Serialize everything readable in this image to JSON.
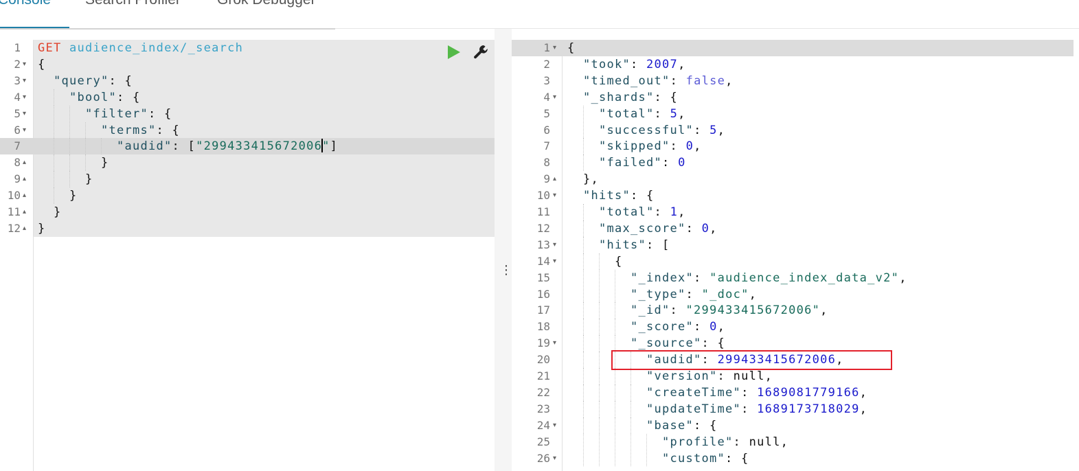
{
  "tabs": [
    {
      "label": "Console",
      "active": true
    },
    {
      "label": "Search Profiler",
      "active": false
    },
    {
      "label": "Grok Debugger",
      "active": false
    }
  ],
  "colors": {
    "accent": "#1e7fa8",
    "run_button": "#54b948",
    "highlight_box": "#e3212b"
  },
  "request_editor": {
    "run_icon": "play-icon",
    "settings_icon": "wrench-icon",
    "active_line": 7,
    "lines": [
      {
        "n": "1",
        "fold": "",
        "indent": 0,
        "tokens": [
          [
            "GET",
            "method"
          ],
          [
            " ",
            "p"
          ],
          [
            "audience_index/_search",
            "url"
          ]
        ]
      },
      {
        "n": "2",
        "fold": "▾",
        "indent": 0,
        "tokens": [
          [
            "{",
            "p"
          ]
        ]
      },
      {
        "n": "3",
        "fold": "▾",
        "indent": 1,
        "tokens": [
          [
            "\"query\"",
            "key"
          ],
          [
            ": {",
            "p"
          ]
        ]
      },
      {
        "n": "4",
        "fold": "▾",
        "indent": 2,
        "tokens": [
          [
            "\"bool\"",
            "key"
          ],
          [
            ": {",
            "p"
          ]
        ]
      },
      {
        "n": "5",
        "fold": "▾",
        "indent": 3,
        "tokens": [
          [
            "\"filter\"",
            "key"
          ],
          [
            ": {",
            "p"
          ]
        ]
      },
      {
        "n": "6",
        "fold": "▾",
        "indent": 4,
        "tokens": [
          [
            "\"terms\"",
            "key"
          ],
          [
            ": {",
            "p"
          ]
        ]
      },
      {
        "n": "7",
        "fold": "",
        "indent": 5,
        "tokens": [
          [
            "\"audid\"",
            "key"
          ],
          [
            ": [",
            "p"
          ],
          [
            "\"299433415672006",
            "str"
          ],
          [
            "|cursor",
            "cursor"
          ],
          [
            "\"",
            "str"
          ],
          [
            "]",
            "p"
          ]
        ]
      },
      {
        "n": "8",
        "fold": "▴",
        "indent": 4,
        "tokens": [
          [
            "}",
            "p"
          ]
        ]
      },
      {
        "n": "9",
        "fold": "▴",
        "indent": 3,
        "tokens": [
          [
            "}",
            "p"
          ]
        ]
      },
      {
        "n": "10",
        "fold": "▴",
        "indent": 2,
        "tokens": [
          [
            "}",
            "p"
          ]
        ]
      },
      {
        "n": "11",
        "fold": "▴",
        "indent": 1,
        "tokens": [
          [
            "}",
            "p"
          ]
        ]
      },
      {
        "n": "12",
        "fold": "▴",
        "indent": 0,
        "tokens": [
          [
            "}",
            "p"
          ]
        ]
      }
    ]
  },
  "splitter_icon": "vertical-ellipsis-icon",
  "response_viewer": {
    "active_line": 1,
    "highlighted_line": 20,
    "lines": [
      {
        "n": "1",
        "fold": "▾",
        "indent": 0,
        "tokens": [
          [
            "{",
            "p"
          ]
        ]
      },
      {
        "n": "2",
        "fold": "",
        "indent": 1,
        "tokens": [
          [
            "\"took\"",
            "key"
          ],
          [
            ": ",
            "p"
          ],
          [
            "2007",
            "num"
          ],
          [
            ",",
            "p"
          ]
        ]
      },
      {
        "n": "3",
        "fold": "",
        "indent": 1,
        "tokens": [
          [
            "\"timed_out\"",
            "key"
          ],
          [
            ": ",
            "p"
          ],
          [
            "false",
            "bool"
          ],
          [
            ",",
            "p"
          ]
        ]
      },
      {
        "n": "4",
        "fold": "▾",
        "indent": 1,
        "tokens": [
          [
            "\"_shards\"",
            "key"
          ],
          [
            ": {",
            "p"
          ]
        ]
      },
      {
        "n": "5",
        "fold": "",
        "indent": 2,
        "tokens": [
          [
            "\"total\"",
            "key"
          ],
          [
            ": ",
            "p"
          ],
          [
            "5",
            "num"
          ],
          [
            ",",
            "p"
          ]
        ]
      },
      {
        "n": "6",
        "fold": "",
        "indent": 2,
        "tokens": [
          [
            "\"successful\"",
            "key"
          ],
          [
            ": ",
            "p"
          ],
          [
            "5",
            "num"
          ],
          [
            ",",
            "p"
          ]
        ]
      },
      {
        "n": "7",
        "fold": "",
        "indent": 2,
        "tokens": [
          [
            "\"skipped\"",
            "key"
          ],
          [
            ": ",
            "p"
          ],
          [
            "0",
            "num"
          ],
          [
            ",",
            "p"
          ]
        ]
      },
      {
        "n": "8",
        "fold": "",
        "indent": 2,
        "tokens": [
          [
            "\"failed\"",
            "key"
          ],
          [
            ": ",
            "p"
          ],
          [
            "0",
            "num"
          ]
        ]
      },
      {
        "n": "9",
        "fold": "▴",
        "indent": 1,
        "tokens": [
          [
            "},",
            "p"
          ]
        ]
      },
      {
        "n": "10",
        "fold": "▾",
        "indent": 1,
        "tokens": [
          [
            "\"hits\"",
            "key"
          ],
          [
            ": {",
            "p"
          ]
        ]
      },
      {
        "n": "11",
        "fold": "",
        "indent": 2,
        "tokens": [
          [
            "\"total\"",
            "key"
          ],
          [
            ": ",
            "p"
          ],
          [
            "1",
            "num"
          ],
          [
            ",",
            "p"
          ]
        ]
      },
      {
        "n": "12",
        "fold": "",
        "indent": 2,
        "tokens": [
          [
            "\"max_score\"",
            "key"
          ],
          [
            ": ",
            "p"
          ],
          [
            "0",
            "num"
          ],
          [
            ",",
            "p"
          ]
        ]
      },
      {
        "n": "13",
        "fold": "▾",
        "indent": 2,
        "tokens": [
          [
            "\"hits\"",
            "key"
          ],
          [
            ": [",
            "p"
          ]
        ]
      },
      {
        "n": "14",
        "fold": "▾",
        "indent": 3,
        "tokens": [
          [
            "{",
            "p"
          ]
        ]
      },
      {
        "n": "15",
        "fold": "",
        "indent": 4,
        "tokens": [
          [
            "\"_index\"",
            "key"
          ],
          [
            ": ",
            "p"
          ],
          [
            "\"audience_index_data_v2\"",
            "str"
          ],
          [
            ",",
            "p"
          ]
        ]
      },
      {
        "n": "16",
        "fold": "",
        "indent": 4,
        "tokens": [
          [
            "\"_type\"",
            "key"
          ],
          [
            ": ",
            "p"
          ],
          [
            "\"_doc\"",
            "str"
          ],
          [
            ",",
            "p"
          ]
        ]
      },
      {
        "n": "17",
        "fold": "",
        "indent": 4,
        "tokens": [
          [
            "\"_id\"",
            "key"
          ],
          [
            ": ",
            "p"
          ],
          [
            "\"299433415672006\"",
            "str"
          ],
          [
            ",",
            "p"
          ]
        ]
      },
      {
        "n": "18",
        "fold": "",
        "indent": 4,
        "tokens": [
          [
            "\"_score\"",
            "key"
          ],
          [
            ": ",
            "p"
          ],
          [
            "0",
            "num"
          ],
          [
            ",",
            "p"
          ]
        ]
      },
      {
        "n": "19",
        "fold": "▾",
        "indent": 4,
        "tokens": [
          [
            "\"_source\"",
            "key"
          ],
          [
            ": {",
            "p"
          ]
        ]
      },
      {
        "n": "20",
        "fold": "",
        "indent": 5,
        "tokens": [
          [
            "\"audid\"",
            "key"
          ],
          [
            ": ",
            "p"
          ],
          [
            "299433415672006",
            "num"
          ],
          [
            ",",
            "p"
          ]
        ]
      },
      {
        "n": "21",
        "fold": "",
        "indent": 5,
        "tokens": [
          [
            "\"version\"",
            "key"
          ],
          [
            ": ",
            "p"
          ],
          [
            "null",
            "null"
          ],
          [
            ",",
            "p"
          ]
        ]
      },
      {
        "n": "22",
        "fold": "",
        "indent": 5,
        "tokens": [
          [
            "\"createTime\"",
            "key"
          ],
          [
            ": ",
            "p"
          ],
          [
            "1689081779166",
            "num"
          ],
          [
            ",",
            "p"
          ]
        ]
      },
      {
        "n": "23",
        "fold": "",
        "indent": 5,
        "tokens": [
          [
            "\"updateTime\"",
            "key"
          ],
          [
            ": ",
            "p"
          ],
          [
            "1689173718029",
            "num"
          ],
          [
            ",",
            "p"
          ]
        ]
      },
      {
        "n": "24",
        "fold": "▾",
        "indent": 5,
        "tokens": [
          [
            "\"base\"",
            "key"
          ],
          [
            ": {",
            "p"
          ]
        ]
      },
      {
        "n": "25",
        "fold": "",
        "indent": 6,
        "tokens": [
          [
            "\"profile\"",
            "key"
          ],
          [
            ": ",
            "p"
          ],
          [
            "null",
            "null"
          ],
          [
            ",",
            "p"
          ]
        ]
      },
      {
        "n": "26",
        "fold": "▾",
        "indent": 6,
        "tokens": [
          [
            "\"custom\"",
            "key"
          ],
          [
            ": {",
            "p"
          ]
        ]
      }
    ]
  }
}
